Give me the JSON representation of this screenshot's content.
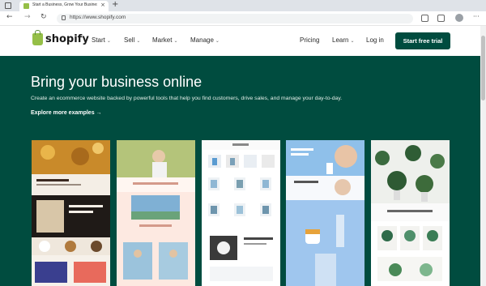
{
  "browser": {
    "tab_title": "Start a Business, Grow Your Business",
    "tab_close": "×",
    "new_tab": "+",
    "back": "←",
    "forward": "→",
    "reload": "↻",
    "url": "https://www.shopify.com",
    "menu": "···"
  },
  "header": {
    "logo": "shopify",
    "nav": [
      {
        "label": "Start",
        "dropdown": true
      },
      {
        "label": "Sell",
        "dropdown": true
      },
      {
        "label": "Market",
        "dropdown": true
      },
      {
        "label": "Manage",
        "dropdown": true
      }
    ],
    "pricing": "Pricing",
    "learn": "Learn",
    "login": "Log in",
    "cta": "Start free trial"
  },
  "hero": {
    "title": "Bring your business online",
    "subtitle": "Create an ecommerce website backed by powerful tools that help you find customers, drive sales, and manage your day-to-day.",
    "explore": "Explore more examples →"
  },
  "showcase": [
    "coffee-store-example",
    "fashion-store-example",
    "product-grid-store-example",
    "skincare-store-example",
    "plants-store-example"
  ],
  "colors": {
    "brand_green": "#004c3f",
    "logo_green": "#95bf47"
  }
}
